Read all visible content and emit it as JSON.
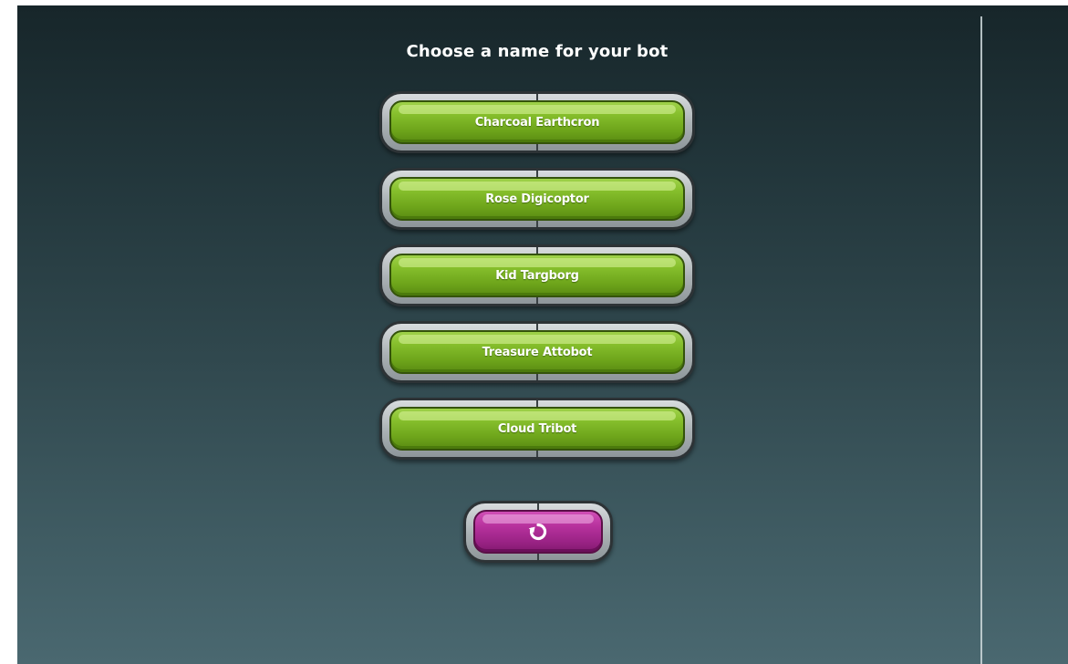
{
  "title": "Choose a name for your bot",
  "names": [
    "Charcoal Earthcron",
    "Rose Digicoptor",
    "Kid Targborg",
    "Treasure Attobot",
    "Cloud Tribot"
  ],
  "refresh": {
    "icon": "refresh-icon"
  },
  "colors": {
    "button_green": "#7cb82a",
    "button_magenta": "#b8329e",
    "background_top": "#17262a",
    "background_bottom": "#4a6870"
  }
}
